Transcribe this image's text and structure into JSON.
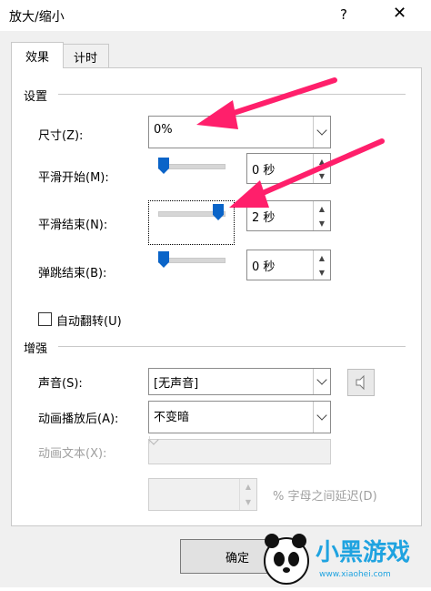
{
  "window": {
    "title": "放大/缩小",
    "help": "?",
    "close": "✕"
  },
  "tabs": [
    {
      "label": "效果"
    },
    {
      "label": "计时"
    }
  ],
  "settings": {
    "group_label": "设置",
    "size": {
      "label": "尺寸(Z):",
      "value": "0%"
    },
    "smooth_start": {
      "label": "平滑开始(M):",
      "value": "0 秒",
      "level": 0
    },
    "smooth_end": {
      "label": "平滑结束(N):",
      "value": "2 秒",
      "level": 1
    },
    "bounce_end": {
      "label": "弹跳结束(B):",
      "value": "0 秒",
      "level": 0
    },
    "auto_reverse": {
      "label": "自动翻转(U)",
      "checked": false
    }
  },
  "enhance": {
    "group_label": "增强",
    "sound": {
      "label": "声音(S):",
      "value": "[无声音]"
    },
    "after_anim": {
      "label": "动画播放后(A):",
      "value": "不变暗"
    },
    "anim_text": {
      "label": "动画文本(X):",
      "value": ""
    },
    "delay": {
      "value": "",
      "suffix": "% 字母之间延迟(D)"
    }
  },
  "buttons": {
    "ok": "确定"
  },
  "watermark": {
    "text": "小黑游戏",
    "url": "www.xiaohei.com"
  },
  "colors": {
    "accent": "#0a64c8",
    "annotation": "#ff1f6b"
  }
}
